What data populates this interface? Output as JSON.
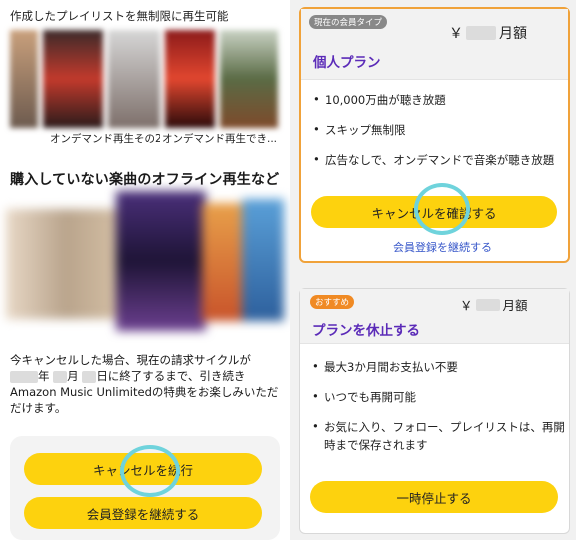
{
  "left_panel": {
    "header_caption": "作成したプレイリストを無制限に再生可能",
    "thumb_caption_1": "オンデマンド再生その2",
    "thumb_caption_2": "オンデマンド再生でき...",
    "offline_title": "購入していない楽曲のオフライン再生など",
    "cancel_info_line1": "今キャンセルした場合、現在の請求サイクルが",
    "cancel_info_year": "年",
    "cancel_info_month": "月",
    "cancel_info_line2_rest": "日に終了するまで、引き続き",
    "cancel_info_line3": "Amazon Music Unlimitedの特典をお楽しみいただ",
    "cancel_info_line4": "だけます。",
    "continue_cancel_label": "キャンセルを続行",
    "keep_membership_label": "会員登録を継続する"
  },
  "right_panel": {
    "current_plan": {
      "tag": "現在の会員タイプ",
      "price_prefix": "￥",
      "price_suffix": "月額",
      "name": "個人プラン",
      "features": [
        "10,000万曲が聴き放題",
        "スキップ無制限",
        "広告なしで、オンデマンドで音楽が聴き放題"
      ],
      "confirm_cancel_label": "キャンセルを確認する",
      "continue_link": "会員登録を継続する"
    },
    "pause_plan": {
      "tag": "おすすめ",
      "price_prefix": "￥",
      "price_suffix": "月額",
      "name": "プランを休止する",
      "features": [
        "最大3か月間お支払い不要",
        "いつでも再開可能",
        "お気に入り、フォロー、プレイリストは、再開",
        "時まで保存されます"
      ],
      "pause_label": "一時停止する"
    }
  },
  "colors": {
    "button_yellow": "#fdd20e",
    "highlight_ring": "#6fd3dc",
    "plan_purple": "#5b2bb8",
    "current_border": "#f0a23a",
    "recommend_tag": "#f08a24",
    "link_blue": "#3656c9"
  }
}
